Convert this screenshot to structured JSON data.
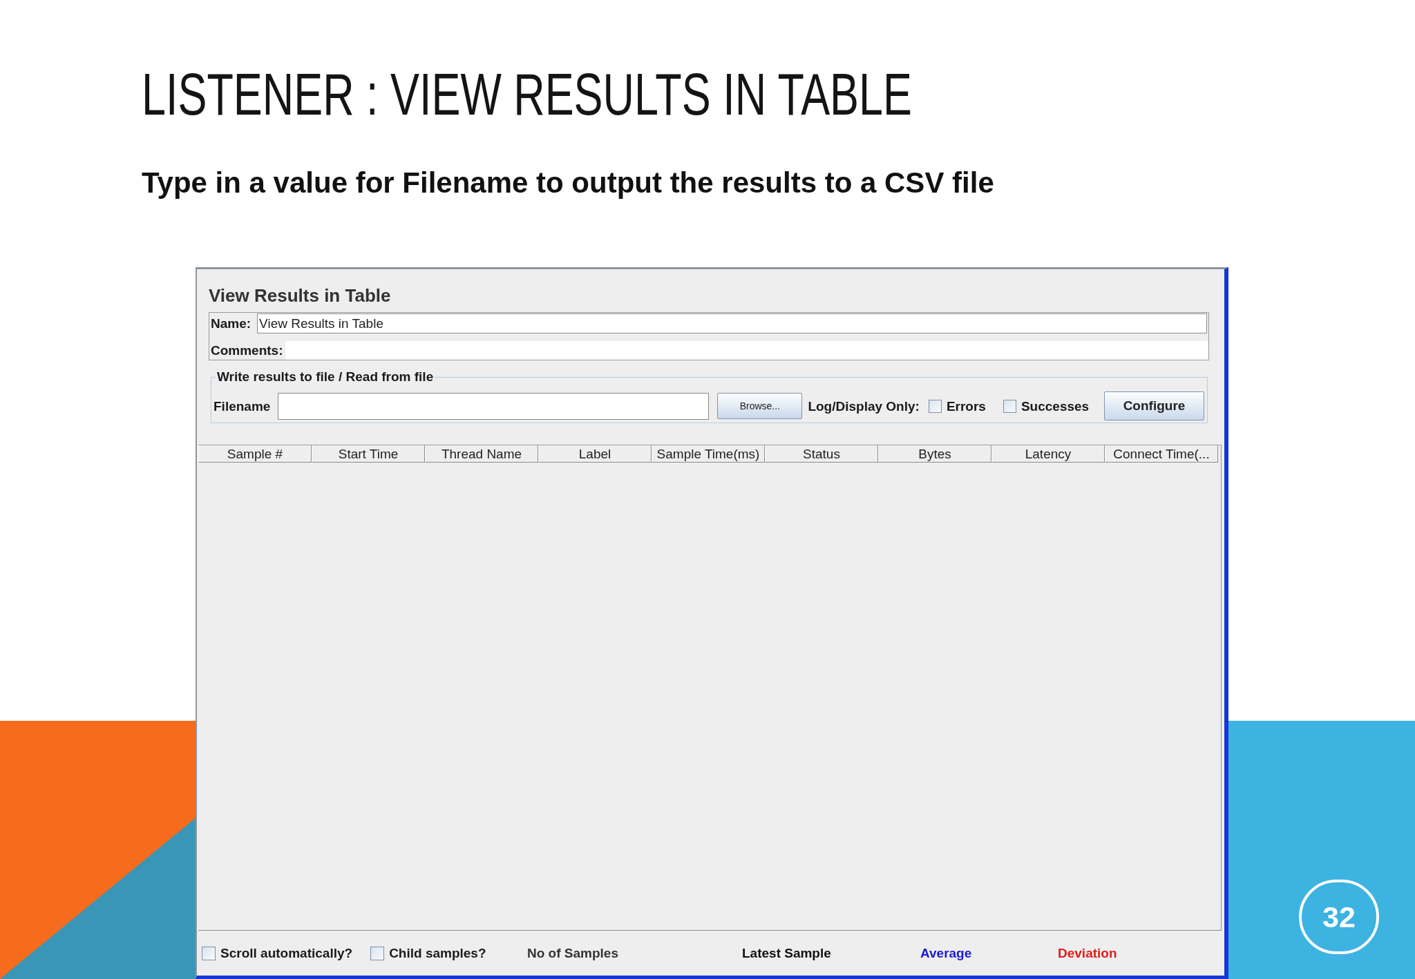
{
  "slide": {
    "title": "LISTENER : VIEW RESULTS IN TABLE",
    "subtitle": "Type in a value for Filename to output the results to a CSV file",
    "page_number": "32"
  },
  "window": {
    "title": "View Results in Table",
    "name": {
      "label": "Name:",
      "value": "View Results in Table"
    },
    "comments": {
      "label": "Comments:"
    },
    "file_group": {
      "legend": "Write results to file / Read from file",
      "filename": {
        "label": "Filename"
      },
      "browse_button": "Browse...",
      "filter_label": "Log/Display Only:",
      "filters": [
        {
          "label": "Errors",
          "checked": false
        },
        {
          "label": "Successes",
          "checked": false
        }
      ],
      "configure_button": "Configure"
    },
    "table": {
      "columns": [
        "Sample #",
        "Start Time",
        "Thread Name",
        "Label",
        "Sample Time(ms)",
        "Status",
        "Bytes",
        "Latency",
        "Connect Time(..."
      ]
    },
    "footer": {
      "options": [
        {
          "label": "Scroll automatically?",
          "checked": false
        },
        {
          "label": "Child samples?",
          "checked": false
        }
      ],
      "stats": [
        {
          "label": "No of Samples",
          "color": "#333333"
        },
        {
          "label": "Latest Sample",
          "color": "#111111"
        },
        {
          "label": "Average",
          "color": "#1a1ad8"
        },
        {
          "label": "Deviation",
          "color": "#e41b1b"
        }
      ]
    }
  }
}
